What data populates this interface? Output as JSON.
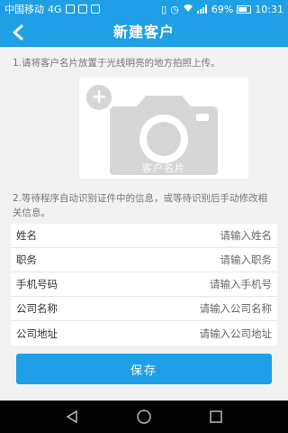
{
  "status_bar": {
    "carrier": "中国移动",
    "network": "4G",
    "battery_text": "69%",
    "time": "10:31"
  },
  "header": {
    "title": "新建客户",
    "back_icon": "back-arrow-icon"
  },
  "instructions": {
    "step1": "1.请将客户名片放置于光线明亮的地方拍照上传。",
    "step2": "2.等待程序自动识别证件中的信息，或等待识别后手动修改相关信息。"
  },
  "card_upload": {
    "label": "客户名片",
    "icon": "camera-icon",
    "add_icon": "plus-icon"
  },
  "form": {
    "fields": [
      {
        "label": "姓名",
        "placeholder": "请输入姓名"
      },
      {
        "label": "职务",
        "placeholder": "请输入职务"
      },
      {
        "label": "手机号码",
        "placeholder": "请输入手机号"
      },
      {
        "label": "公司名称",
        "placeholder": "请输入公司名称"
      },
      {
        "label": "公司地址",
        "placeholder": "请输入公司地址"
      }
    ]
  },
  "actions": {
    "save_label": "保存"
  },
  "colors": {
    "primary": "#1fa0e6",
    "background": "#f2f2f2",
    "placeholder_gray": "#d6d6d6"
  }
}
